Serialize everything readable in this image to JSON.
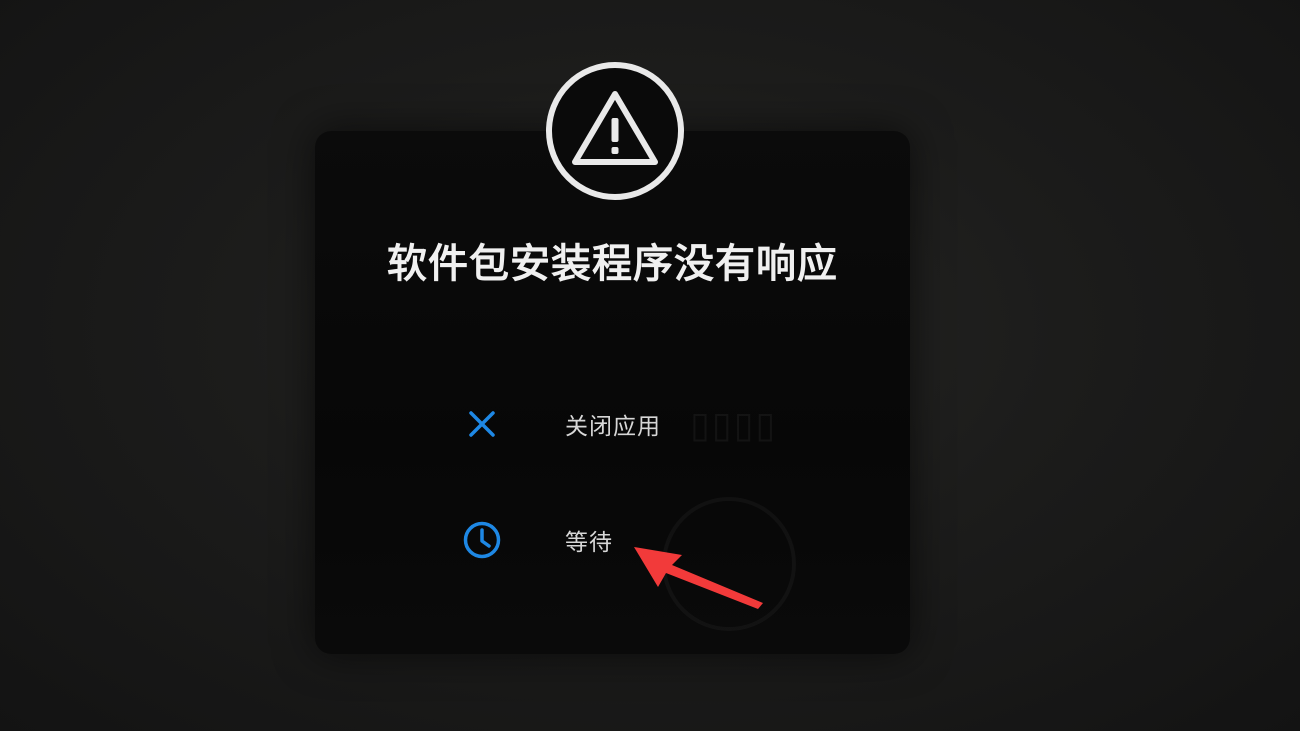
{
  "dialog": {
    "title": "软件包安装程序没有响应",
    "warning_icon": "warning-triangle-icon",
    "options": [
      {
        "icon": "close-x-icon",
        "label": "关闭应用"
      },
      {
        "icon": "clock-icon",
        "label": "等待"
      }
    ]
  },
  "colors": {
    "accent_blue": "#1e88e5",
    "annotation_red": "#f23a3a",
    "text_primary": "#f0f0f0",
    "dialog_bg": "#0a0a0a"
  }
}
